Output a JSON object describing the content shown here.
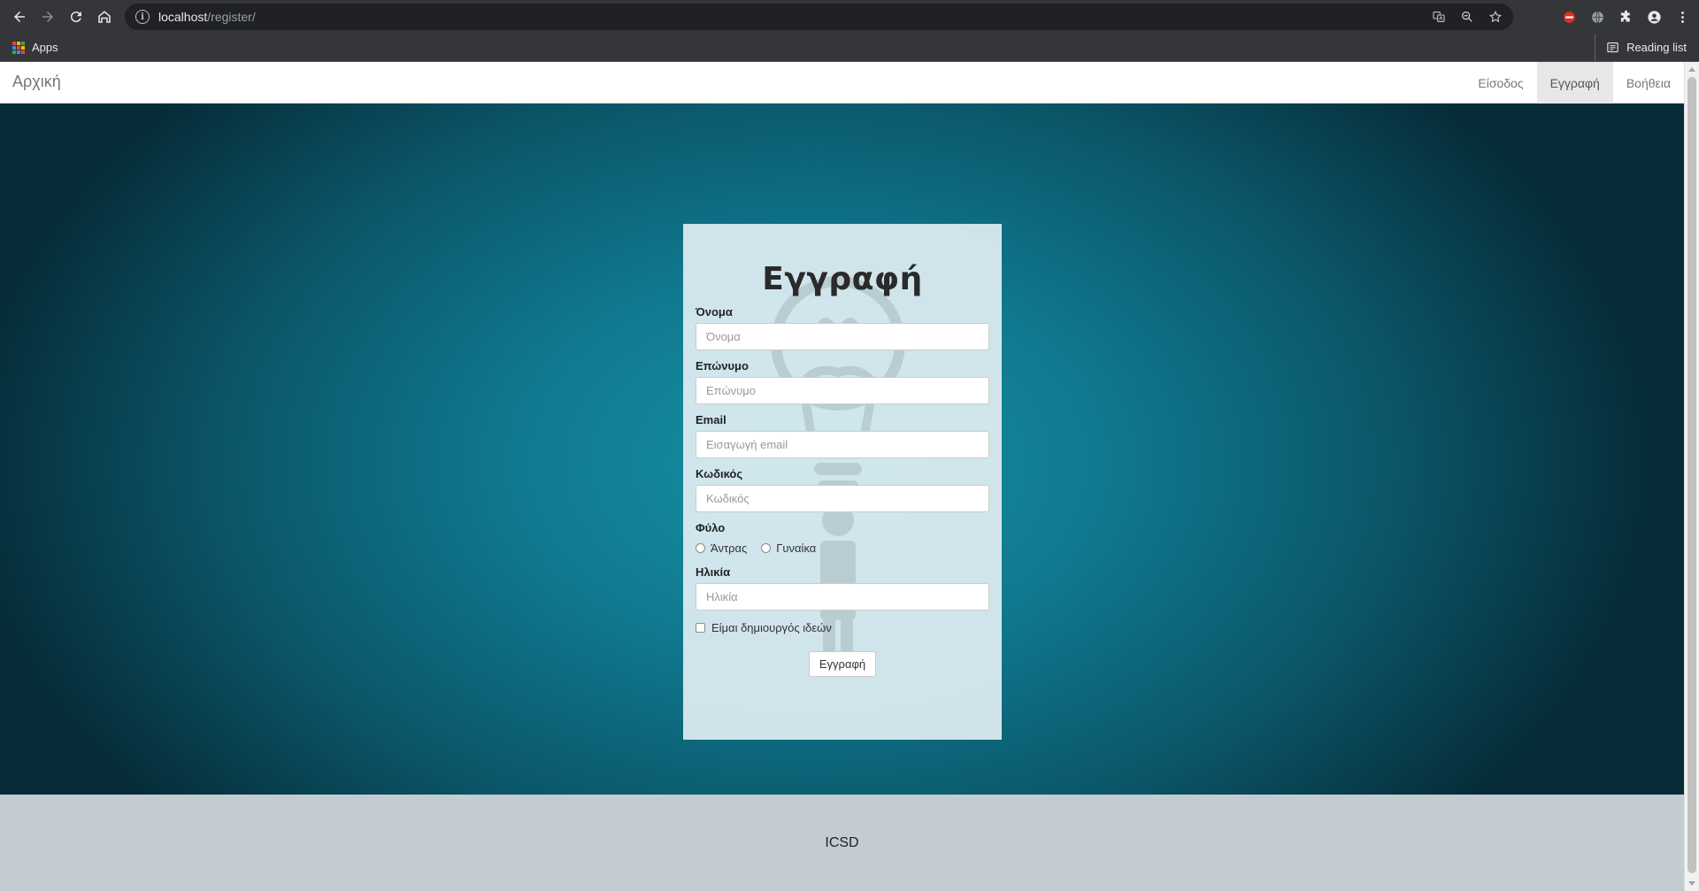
{
  "browser": {
    "url_host": "localhost",
    "url_path": "/register/",
    "bookmarks": {
      "apps_label": "Apps",
      "reading_list_label": "Reading list"
    }
  },
  "navbar": {
    "brand": "Αρχική",
    "links": [
      {
        "label": "Είσοδος",
        "active": false
      },
      {
        "label": "Εγγραφή",
        "active": true
      },
      {
        "label": "Βοήθεια",
        "active": false
      }
    ]
  },
  "form": {
    "title": "Εγγραφή",
    "first_name": {
      "label": "Όνομα",
      "placeholder": "Όνομα",
      "value": ""
    },
    "last_name": {
      "label": "Επώνυμο",
      "placeholder": "Επώνυμο",
      "value": ""
    },
    "email": {
      "label": "Email",
      "placeholder": "Εισαγωγή email",
      "value": ""
    },
    "password": {
      "label": "Κωδικός",
      "placeholder": "Κωδικός",
      "value": ""
    },
    "gender": {
      "label": "Φύλο",
      "options": [
        "Άντρας",
        "Γυναίκα"
      ],
      "selected": null
    },
    "age": {
      "label": "Ηλικία",
      "placeholder": "Ηλικία",
      "value": ""
    },
    "idea_creator": {
      "label": "Είμαι δημιουργός ιδεών",
      "checked": false
    },
    "submit_label": "Εγγραφή"
  },
  "footer": {
    "text": "ICSD"
  },
  "colors": {
    "background_center": "#1590a6",
    "background_edge": "#062c38",
    "card_background": "#e1eef3",
    "footer_background": "#c2ccd1",
    "navbar_active": "#e7e7e7"
  }
}
